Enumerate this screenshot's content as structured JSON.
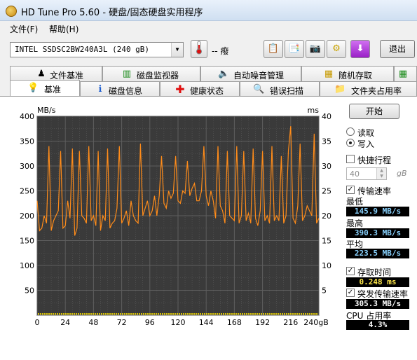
{
  "window": {
    "title": "HD Tune Pro 5.60 - 硬盘/固态硬盘实用程序"
  },
  "menu": [
    {
      "label": "文件(F)"
    },
    {
      "label": "帮助(H)"
    }
  ],
  "toolbar": {
    "drive": "INTEL SSDSC2BW240A3L (240 gB)",
    "temperature": "-- 癈",
    "exit_label": "退出"
  },
  "tabs_row1": [
    {
      "label": "文件基准",
      "icon": "file-benchmark-icon"
    },
    {
      "label": "磁盘监视器",
      "icon": "disk-monitor-icon"
    },
    {
      "label": "自动噪音管理",
      "icon": "speaker-icon"
    },
    {
      "label": "随机存取",
      "icon": "random-access-icon"
    }
  ],
  "tabs_row2": [
    {
      "label": "基准",
      "icon": "lightbulb-icon",
      "active": true
    },
    {
      "label": "磁盘信息",
      "icon": "info-icon"
    },
    {
      "label": "健康状态",
      "icon": "red-cross-icon"
    },
    {
      "label": "错误扫描",
      "icon": "magnifier-icon"
    },
    {
      "label": "文件夹占用率",
      "icon": "folder-icon"
    }
  ],
  "controls": {
    "start_label": "开始",
    "read_label": "读取",
    "write_label": "写入",
    "mode": "write",
    "short_stroke_label": "快捷行程",
    "short_stroke_checked": false,
    "short_stroke_value": "40",
    "short_stroke_unit": "gB",
    "transfer_rate_label": "传输速率",
    "transfer_rate_checked": true,
    "min_label": "最低",
    "min_value": "145.9 MB/s",
    "max_label": "最高",
    "max_value": "390.3 MB/s",
    "avg_label": "平均",
    "avg_value": "223.5 MB/s",
    "access_time_label": "存取时间",
    "access_time_checked": true,
    "access_time_value": "0.248 ms",
    "burst_label": "突发传输速率",
    "burst_checked": true,
    "burst_value": "305.3 MB/s",
    "cpu_label": "CPU 占用率",
    "cpu_value": "4.3%"
  },
  "colors": {
    "transfer_line": "#ff8c1a",
    "access_points": "#ffe600",
    "plot_bg": "#3a3a3a",
    "grid": "#5e5e5e"
  },
  "chart_data": {
    "type": "line",
    "ylabel_left": "MB/s",
    "ylabel_right": "ms",
    "x_ticks": [
      "0",
      "24",
      "48",
      "72",
      "96",
      "120",
      "144",
      "168",
      "192",
      "216",
      "240gB"
    ],
    "y_ticks_left": [
      "400",
      "350",
      "300",
      "250",
      "200",
      "150",
      "100",
      "50"
    ],
    "y_ticks_right": [
      "40",
      "35",
      "30",
      "25",
      "20",
      "15",
      "10",
      "5"
    ],
    "xlim": [
      0,
      240
    ],
    "ylim_left": [
      0,
      400
    ],
    "ylim_right": [
      0,
      40
    ],
    "grid": true,
    "series": [
      {
        "name": "传输速率",
        "axis": "left",
        "x": [
          0,
          2,
          4,
          6,
          8,
          10,
          12,
          14,
          16,
          18,
          20,
          22,
          24,
          26,
          28,
          30,
          32,
          34,
          36,
          38,
          40,
          42,
          44,
          46,
          48,
          50,
          52,
          54,
          56,
          58,
          60,
          62,
          64,
          66,
          68,
          70,
          72,
          74,
          76,
          78,
          80,
          82,
          84,
          86,
          88,
          90,
          92,
          94,
          96,
          98,
          100,
          102,
          104,
          106,
          108,
          110,
          112,
          114,
          116,
          118,
          120,
          122,
          124,
          126,
          128,
          130,
          132,
          134,
          136,
          138,
          140,
          142,
          144,
          146,
          148,
          150,
          152,
          154,
          156,
          158,
          160,
          162,
          164,
          166,
          168,
          170,
          172,
          174,
          176,
          178,
          180,
          182,
          184,
          186,
          188,
          190,
          192,
          194,
          196,
          198,
          200,
          202,
          204,
          206,
          208,
          210,
          212,
          214,
          216,
          218,
          220,
          222,
          224,
          226,
          228,
          230,
          232,
          234,
          236,
          238,
          240
        ],
        "y": [
          230,
          170,
          175,
          200,
          185,
          340,
          170,
          190,
          200,
          210,
          330,
          175,
          180,
          230,
          195,
          335,
          160,
          175,
          330,
          200,
          195,
          185,
          340,
          190,
          200,
          180,
          330,
          170,
          200,
          190,
          335,
          175,
          185,
          190,
          215,
          340,
          185,
          195,
          210,
          180,
          230,
          200,
          190,
          185,
          345,
          200,
          215,
          230,
          200,
          210,
          240,
          200,
          240,
          320,
          225,
          215,
          250,
          235,
          245,
          320,
          230,
          225,
          250,
          245,
          310,
          240,
          255,
          265,
          230,
          230,
          250,
          340,
          240,
          220,
          250,
          230,
          195,
          340,
          220,
          210,
          185,
          330,
          200,
          195,
          190,
          340,
          185,
          200,
          330,
          190,
          205,
          185,
          335,
          195,
          180,
          210,
          330,
          190,
          200,
          185,
          340,
          190,
          200,
          190,
          320,
          185,
          200,
          330,
          380,
          195,
          185,
          220,
          345,
          190,
          200,
          220,
          210,
          200,
          365,
          185,
          195
        ]
      },
      {
        "name": "存取时间",
        "axis": "right",
        "value_ms_typical": 0.25
      }
    ]
  }
}
